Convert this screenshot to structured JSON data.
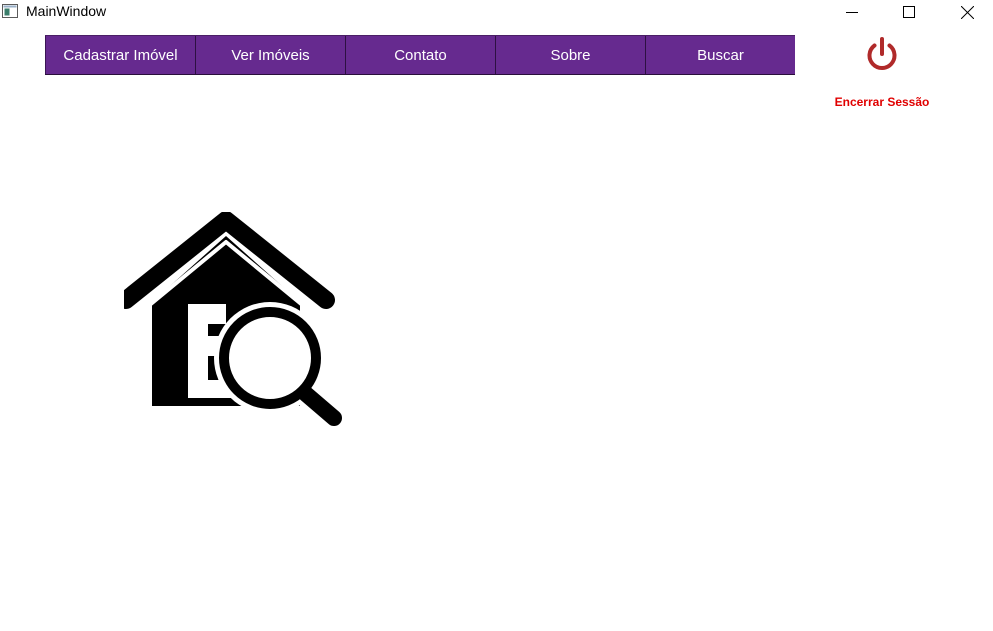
{
  "window": {
    "title": "MainWindow",
    "controls": {
      "minimize_icon": "minimize-icon",
      "maximize_icon": "maximize-icon",
      "close_icon": "close-icon"
    }
  },
  "menu": {
    "background_color": "#662a8f",
    "items": [
      {
        "label": "Cadastrar Imóvel"
      },
      {
        "label": "Ver Imóveis"
      },
      {
        "label": "Contato"
      },
      {
        "label": "Sobre"
      },
      {
        "label": "Buscar"
      }
    ]
  },
  "logout": {
    "icon": "power-icon",
    "icon_color": "#b02a2a",
    "label": "Encerrar Sessão",
    "label_color": "#e00000"
  },
  "logo": {
    "icon": "house-search-logo-icon"
  }
}
